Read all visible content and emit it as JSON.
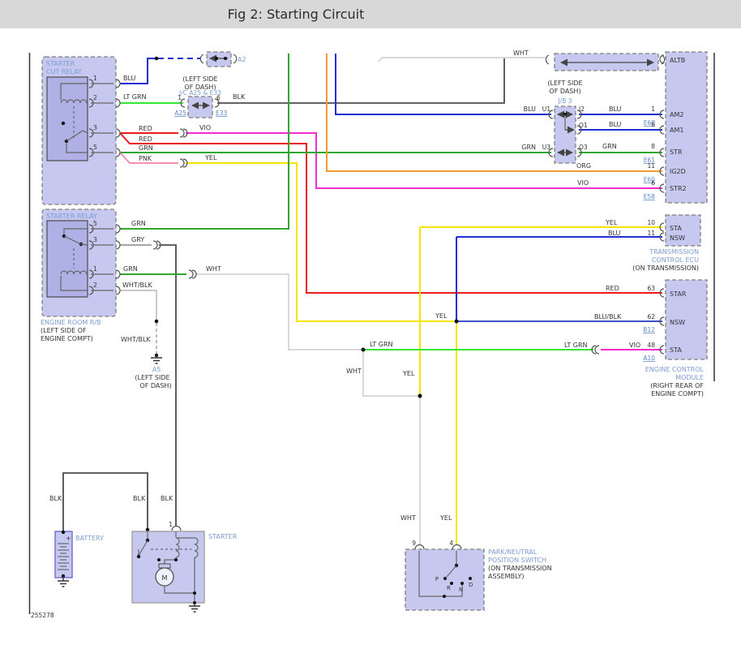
{
  "header": {
    "title": "Fig 2: Starting Circuit"
  },
  "footer": {
    "code": "255278"
  },
  "cut_relay": {
    "title1": "STARTER",
    "title2": "CUT RELAY",
    "pin1": "1",
    "pin2": "2",
    "pin3": "3",
    "pin5": "5",
    "lbl_blu": "BLU",
    "lbl_ltgrn": "LT GRN",
    "lbl_red1": "RED",
    "lbl_red2": "RED",
    "lbl_grn": "GRN",
    "lbl_pnk": "PNK",
    "lbl_vio": "VIO",
    "lbl_yel": "YEL",
    "lbl_blk": "BLK"
  },
  "a2_conn": {
    "id": "A2"
  },
  "jc": {
    "loc1": "(LEFT SIDE",
    "loc2": "OF DASH)",
    "name": "J/C A25 & E33",
    "pin_l": "1",
    "pin_r": "6",
    "id_l": "A25",
    "id_r": "E33"
  },
  "jb3": {
    "loc1": "(LEFT SIDE",
    "loc2": "OF DASH)",
    "name": "J/B 3",
    "lbl_blu": "BLU",
    "u1": "U1",
    "i2": "I2",
    "o1": "O1",
    "lbl_grn": "GRN",
    "u3": "U3",
    "o3": "O3"
  },
  "top_wht": {
    "label": "WHT"
  },
  "top_module": {
    "altb": "ALTB",
    "am2": {
      "wire": "BLU",
      "pin": "1",
      "conn": "E60",
      "name": "AM2"
    },
    "am1": {
      "wire": "BLU",
      "pin": "6",
      "name": "AM1"
    },
    "str": {
      "wire": "GRN",
      "pin": "8",
      "conn": "E61",
      "name": "STR"
    },
    "ig2d": {
      "wire": "ORG",
      "pin": "11",
      "conn": "E60",
      "name": "IG2D"
    },
    "str2": {
      "wire": "VIO",
      "pin": "6",
      "conn": "E58",
      "name": "STR2"
    }
  },
  "starter_relay": {
    "title": "STARTER RELAY",
    "pin5": "5",
    "pin3": "3",
    "pin1": "1",
    "pin2": "2",
    "lbl_grn5": "GRN",
    "lbl_gry": "GRY",
    "lbl_grn1": "GRN",
    "lbl_wht": "WHT",
    "lbl_whtblk": "WHT/BLK"
  },
  "engine_room": {
    "name": "ENGINE ROOM R/B",
    "loc1": "(LEFT SIDE OF",
    "loc2": "ENGINE COMPT)"
  },
  "a5_ground": {
    "lbl": "WHT/BLK",
    "id": "A5",
    "loc1": "(LEFT SIDE",
    "loc2": "OF DASH)"
  },
  "tcm": {
    "sta": {
      "wire": "YEL",
      "pin": "10",
      "name": "STA"
    },
    "nsw": {
      "wire": "BLU",
      "pin": "11",
      "name": "NSW"
    },
    "name1": "TRANSMISSION",
    "name2": "CONTROL ECU",
    "loc": "(ON TRANSMISSION)"
  },
  "ecm": {
    "star": {
      "wire": "RED",
      "pin": "63",
      "name": "STAR"
    },
    "nsw": {
      "wire": "BLU/BLK",
      "pin": "62",
      "conn": "B12",
      "name": "NSW"
    },
    "sta": {
      "wire": "VIO",
      "pin": "48",
      "conn": "A10",
      "name": "STA"
    },
    "name1": "ENGINE CONTROL",
    "name2": "MODULE",
    "loc1": "(RIGHT REAR OF",
    "loc2": "ENGINE COMPT)"
  },
  "mid": {
    "yel_nsw": "YEL",
    "ltgrn1": "LT GRN",
    "ltgrn2": "LT GRN",
    "vio": "VIO",
    "wht1": "WHT",
    "yel1": "YEL",
    "wht2": "WHT",
    "yel2": "YEL"
  },
  "pnp": {
    "pin9": "9",
    "pin4": "4",
    "p": "P",
    "r": "R",
    "n": "N",
    "d": "D",
    "name1": "PARK/NEUTRAL",
    "name2": "POSITION SWITCH",
    "loc1": "(ON TRANSMISSION",
    "loc2": "ASSEMBLY)"
  },
  "battery": {
    "name": "BATTERY",
    "plus": "+",
    "lbl_blk": "BLK"
  },
  "starter": {
    "name": "STARTER",
    "pin1": "1",
    "lbl_blk1": "BLK",
    "lbl_blk2": "BLK",
    "motor": "M"
  },
  "colors": {
    "blu": "#1f2fd4",
    "lt_grn": "#35e835",
    "grn": "#2fa82f",
    "red": "#ea1c1c",
    "pnk": "#f490b8",
    "yel": "#f5e400",
    "vio": "#f32cd0",
    "org": "#f49b33",
    "wht": "#d9d9d9",
    "blk": "#4d4d4d",
    "gry": "#a6a6a6",
    "blu_blk": "#3f51c9",
    "wht_blk": "#c9c9c9",
    "module_fill": "#c7c8ef",
    "label_blue": "#7b9cd0"
  }
}
